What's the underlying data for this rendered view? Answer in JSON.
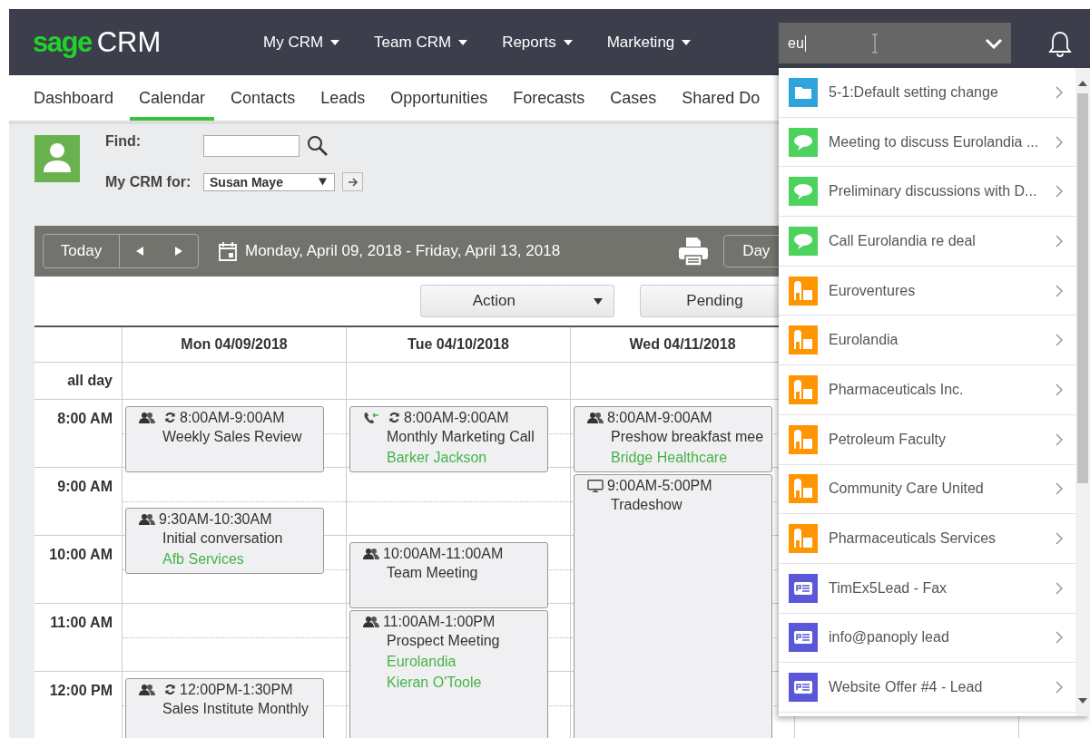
{
  "header": {
    "logo": {
      "brand": "sage",
      "product": "CRM"
    },
    "menus": [
      "My CRM",
      "Team CRM",
      "Reports",
      "Marketing"
    ],
    "search": {
      "value": "eu"
    }
  },
  "tabs": [
    {
      "label": "Dashboard",
      "selected": false
    },
    {
      "label": "Calendar",
      "selected": true
    },
    {
      "label": "Contacts",
      "selected": false
    },
    {
      "label": "Leads",
      "selected": false
    },
    {
      "label": "Opportunities",
      "selected": false
    },
    {
      "label": "Forecasts",
      "selected": false
    },
    {
      "label": "Cases",
      "selected": false
    },
    {
      "label": "Shared Do",
      "selected": false
    }
  ],
  "filter": {
    "find_label": "Find:",
    "owner_label": "My CRM for:",
    "owner": "Susan Maye"
  },
  "toolbar": {
    "today": "Today",
    "range": "Monday, April 09, 2018 - Friday, April 13, 2018",
    "view": "Day"
  },
  "actions": [
    {
      "kind": "dropdown",
      "label": "Action"
    },
    {
      "kind": "button",
      "label": "Pending"
    }
  ],
  "calendar": {
    "all_day_label": "all day",
    "hours": [
      "8:00 AM",
      "9:00 AM",
      "10:00 AM",
      "11:00 AM",
      "12:00 PM"
    ],
    "days": [
      {
        "label": "Mon 04/09/2018",
        "events": [
          {
            "kind": "meeting",
            "recurring": true,
            "time": "8:00AM-9:00AM",
            "title": "Weekly Sales Review"
          },
          {
            "kind": "meeting",
            "recurring": false,
            "time": "9:30AM-10:30AM",
            "title": "Initial conversation",
            "links": [
              "Afb Services"
            ]
          },
          {
            "kind": "meeting",
            "recurring": true,
            "time": "12:00PM-1:30PM",
            "title": "Sales Institute Monthly"
          }
        ]
      },
      {
        "label": "Tue 04/10/2018",
        "events": [
          {
            "kind": "call",
            "recurring": true,
            "time": "8:00AM-9:00AM",
            "title": "Monthly Marketing Call",
            "links": [
              "Barker Jackson"
            ]
          },
          {
            "kind": "meeting",
            "recurring": false,
            "time": "10:00AM-11:00AM",
            "title": "Team Meeting"
          },
          {
            "kind": "meeting",
            "recurring": false,
            "time": "11:00AM-1:00PM",
            "title": "Prospect Meeting",
            "links": [
              "Eurolandia",
              "Kieran O'Toole"
            ]
          }
        ]
      },
      {
        "label": "Wed 04/11/2018",
        "events": [
          {
            "kind": "meeting",
            "recurring": false,
            "time": "8:00AM-9:00AM",
            "title": "Preshow breakfast mee",
            "links": [
              "Bridge Healthcare"
            ]
          },
          {
            "kind": "demo",
            "recurring": false,
            "time": "9:00AM-5:00PM",
            "title": "Tradeshow"
          }
        ]
      }
    ]
  },
  "results": [
    {
      "kind": "case",
      "label": "5-1:Default setting change"
    },
    {
      "kind": "communication",
      "label": "Meeting to discuss Eurolandia ..."
    },
    {
      "kind": "communication",
      "label": "Preliminary discussions with D..."
    },
    {
      "kind": "communication",
      "label": "Call Eurolandia re deal"
    },
    {
      "kind": "company",
      "label": "Euroventures"
    },
    {
      "kind": "company",
      "label": "Eurolandia"
    },
    {
      "kind": "company",
      "label": "Pharmaceuticals Inc."
    },
    {
      "kind": "company",
      "label": "Petroleum Faculty"
    },
    {
      "kind": "company",
      "label": "Community Care United"
    },
    {
      "kind": "company",
      "label": "Pharmaceuticals Services"
    },
    {
      "kind": "lead",
      "label": "TimEx5Lead - Fax"
    },
    {
      "kind": "lead",
      "label": "info@panoply lead"
    },
    {
      "kind": "lead",
      "label": "Website Offer #4 - Lead"
    }
  ]
}
